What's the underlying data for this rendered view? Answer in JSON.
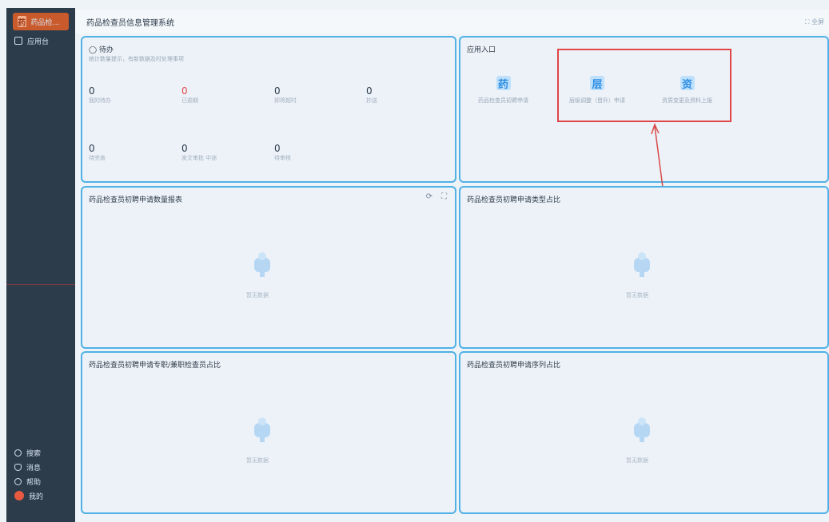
{
  "sidebar": {
    "logo_letter": "药",
    "app_short": "药品检查员...",
    "items": [
      {
        "label": "应用台",
        "icon": "grid-icon"
      }
    ],
    "bottom": [
      {
        "label": "搜索",
        "icon": "search-icon"
      },
      {
        "label": "消息",
        "icon": "bell-icon"
      },
      {
        "label": "帮助",
        "icon": "help-icon"
      },
      {
        "label": "我的",
        "icon": "user-icon"
      }
    ]
  },
  "topbar": {
    "title": "药品检查员信息管理系统",
    "right": "全屏"
  },
  "todo": {
    "title": "待办",
    "subtitle": "统计数量提示，有新数据及时处理事项",
    "metrics": [
      {
        "value": "0",
        "label": "我的待办"
      },
      {
        "value": "0",
        "label": "已逾期"
      },
      {
        "value": "0",
        "label": "即将超时"
      },
      {
        "value": "0",
        "label": "抄送"
      },
      {
        "value": "0",
        "label": "待完善"
      },
      {
        "value": "0",
        "label": "发文审批 中途"
      },
      {
        "value": "0",
        "label": "待审核"
      }
    ]
  },
  "shortcuts": {
    "title": "应用入口",
    "items": [
      {
        "icon": "药",
        "label": "药品检查员初聘申请"
      },
      {
        "icon": "层",
        "label": "层级调整（晋升）申请"
      },
      {
        "icon": "资",
        "label": "资质变更及资料上报"
      }
    ]
  },
  "charts": [
    {
      "title": "药品检查员初聘申请数量报表",
      "empty": "暂无数据"
    },
    {
      "title": "药品检查员初聘申请类型占比",
      "empty": "暂无数据"
    },
    {
      "title": "药品检查员初聘申请专职/兼职检查员占比",
      "empty": "暂无数据"
    },
    {
      "title": "药品检查员初聘申请序列占比",
      "empty": "暂无数据"
    }
  ],
  "colors": {
    "accent": "#4fb1e6",
    "danger": "#e04646",
    "sidebar": "#2d3c4b"
  }
}
